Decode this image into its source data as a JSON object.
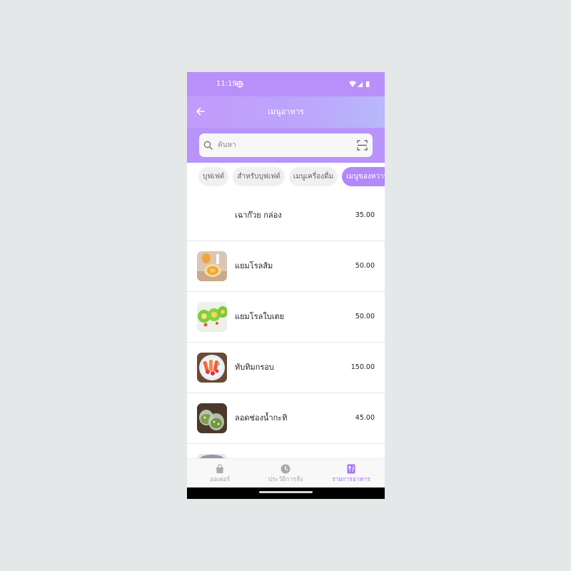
{
  "status_bar": {
    "time": "11:19"
  },
  "app_bar": {
    "title": "เมนูอาหาร"
  },
  "search": {
    "placeholder": "ค้นหา"
  },
  "tabs": [
    {
      "label": "บุฟเฟต์",
      "active": false
    },
    {
      "label": "สำหรับบุฟเฟต์",
      "active": false
    },
    {
      "label": "เมนูเครื่องดื่ม",
      "active": false
    },
    {
      "label": "เมนูของหวาน",
      "active": true
    }
  ],
  "menu_items": [
    {
      "name": "เฉาก๊วย กล่อง",
      "price": "35.00",
      "image": "none"
    },
    {
      "name": "แยมโรลส้ม",
      "price": "50.00",
      "image": "orange-jam-roll"
    },
    {
      "name": "แยมโรลใบเตย",
      "price": "50.00",
      "image": "pandan-jam-roll"
    },
    {
      "name": "ทับทิมกรอบ",
      "price": "150.00",
      "image": "tub-tim-krob"
    },
    {
      "name": "ลอดช่องน้ำกะทิ",
      "price": "45.00",
      "image": "lod-chong"
    }
  ],
  "bottom_nav": [
    {
      "label": "ออเดอร์",
      "icon": "bag-icon",
      "active": false
    },
    {
      "label": "ประวัติการสั่ง",
      "icon": "clock-icon",
      "active": false
    },
    {
      "label": "รายการอาหาร",
      "icon": "menu-book-icon",
      "active": true
    }
  ],
  "colors": {
    "accent": "#b289f9",
    "header": "#b98ffa",
    "active_nav": "#a874f6"
  }
}
